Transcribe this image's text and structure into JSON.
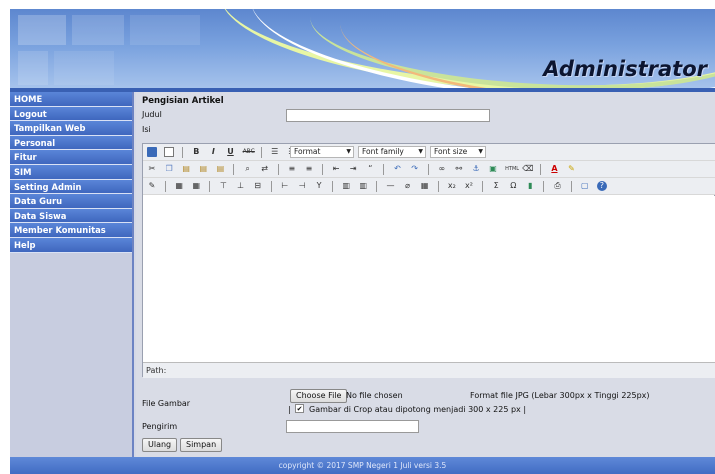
{
  "header": {
    "title": "Administrator"
  },
  "sidebar": {
    "items": [
      {
        "label": "HOME"
      },
      {
        "label": "Logout"
      },
      {
        "label": "Tampilkan Web"
      },
      {
        "label": "Personal"
      },
      {
        "label": "Fitur"
      },
      {
        "label": "SIM"
      },
      {
        "label": "Setting Admin"
      },
      {
        "label": "Data Guru"
      },
      {
        "label": "Data Siswa"
      },
      {
        "label": "Member Komunitas"
      },
      {
        "label": "Help"
      }
    ]
  },
  "form": {
    "heading": "Pengisian Artikel",
    "judul_label": "Judul",
    "judul_value": "",
    "isi_label": "Isi",
    "editor": {
      "format_select": "Format",
      "font_family_select": "Font family",
      "font_size_select": "Font size",
      "path_label": "Path:"
    },
    "file_label": "File Gambar",
    "choose_file_button": "Choose File",
    "no_file_text": "No file chosen",
    "format_note": "Format file JPG (Lebar 300px x Tinggi 225px)",
    "crop_checked": true,
    "crop_label": "Gambar di Crop atau dipotong menjadi 300 x 225 px |",
    "pengirim_label": "Pengirim",
    "pengirim_value": "",
    "reset_button": "Ulang",
    "submit_button": "Simpan"
  },
  "footer": {
    "text": "copyright © 2017 SMP Negeri 1 Juli versi 3.5"
  },
  "colors": {
    "nav": "#4a74cc",
    "header": "#6a95da",
    "footer": "#4a74cc",
    "sidebar_bg": "#c8cde0"
  }
}
